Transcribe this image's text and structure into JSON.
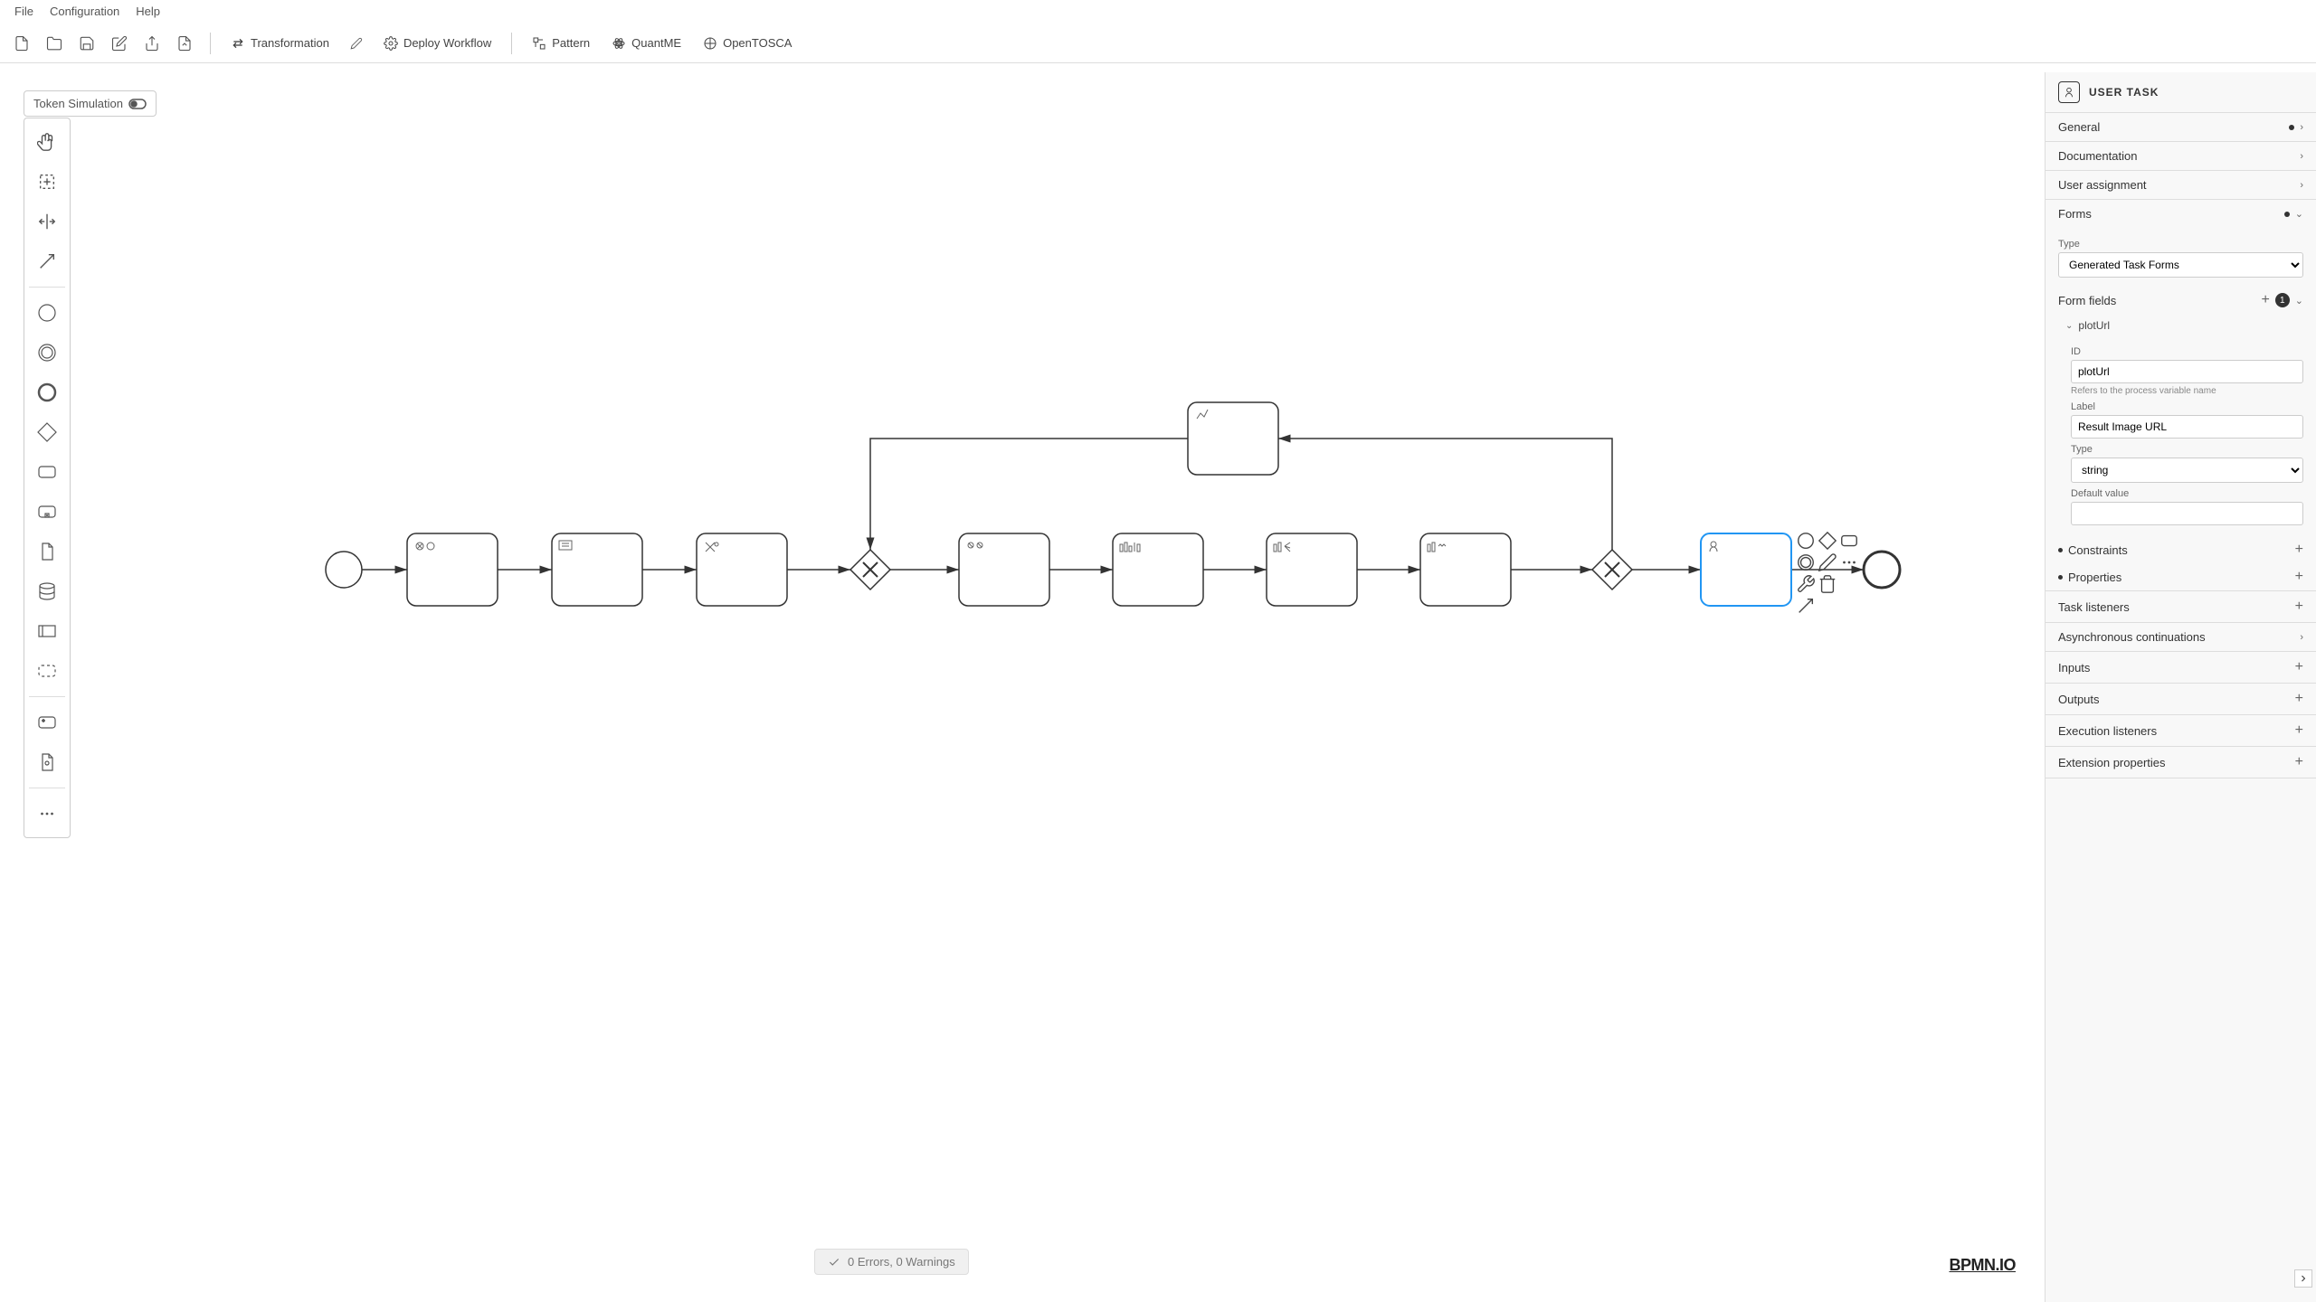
{
  "menubar": {
    "items": [
      "File",
      "Configuration",
      "Help"
    ]
  },
  "toolbar": {
    "transformation": "Transformation",
    "deploy": "Deploy Workflow",
    "pattern": "Pattern",
    "quantme": "QuantME",
    "opentosca": "OpenTOSCA"
  },
  "token_sim": "Token Simulation",
  "status": "0 Errors, 0 Warnings",
  "bpmn_logo": "BPMN.IO",
  "properties": {
    "header": "USER TASK",
    "groups": {
      "general": "General",
      "documentation": "Documentation",
      "user_assignment": "User assignment",
      "forms": "Forms",
      "task_listeners": "Task listeners",
      "async": "Asynchronous continuations",
      "inputs": "Inputs",
      "outputs": "Outputs",
      "exec_listeners": "Execution listeners",
      "ext_props": "Extension properties"
    },
    "forms": {
      "type_label": "Type",
      "type_value": "Generated Task Forms",
      "form_fields_label": "Form fields",
      "form_fields_count": "1",
      "field_name": "plotUrl",
      "id_label": "ID",
      "id_value": "plotUrl",
      "id_hint": "Refers to the process variable name",
      "label_label": "Label",
      "label_value": "Result Image URL",
      "field_type_label": "Type",
      "field_type_value": "string",
      "default_label": "Default value",
      "default_value": "",
      "constraints": "Constraints",
      "props": "Properties"
    }
  }
}
